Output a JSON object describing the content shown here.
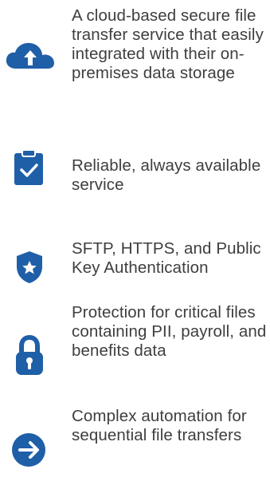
{
  "accent_color": "#1f5fa8",
  "features": [
    {
      "icon": "cloud-upload-icon",
      "text": "A cloud-based secure file transfer service that easily integrated with their on-premises data storage"
    },
    {
      "icon": "clipboard-check-icon",
      "text": "Reliable, always available service"
    },
    {
      "icon": "shield-star-icon",
      "text": "SFTP, HTTPS, and Public Key Authentication"
    },
    {
      "icon": "padlock-icon",
      "text": "Protection for critical files containing PII, payroll, and benefits data"
    },
    {
      "icon": "arrow-right-circle-icon",
      "text": "Complex automation for sequential file transfers"
    }
  ]
}
